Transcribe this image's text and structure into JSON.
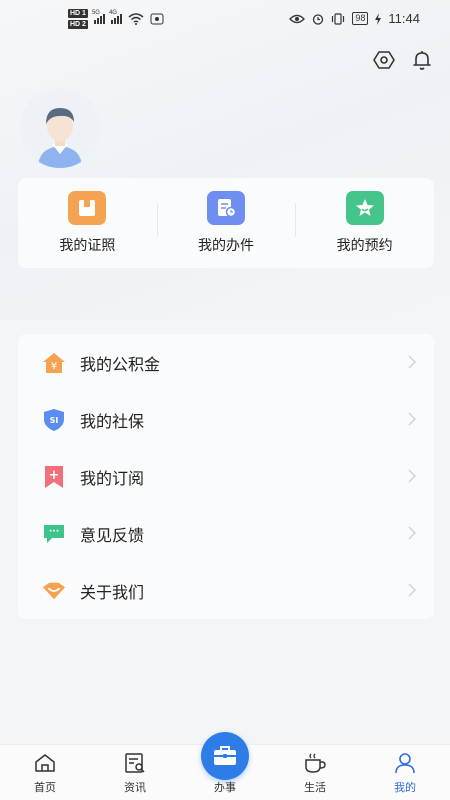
{
  "status_bar": {
    "hd1": "HD 1",
    "hd2": "HD 2",
    "sig1_tag": "5G",
    "sig2_tag": "4G",
    "battery": "98",
    "time": "11:44"
  },
  "services": [
    {
      "label": "我的证照",
      "icon": "license-icon",
      "color": "#f5a251"
    },
    {
      "label": "我的办件",
      "icon": "document-clock-icon",
      "color": "#6f8ff0"
    },
    {
      "label": "我的预约",
      "icon": "star-icon",
      "color": "#45c48b"
    }
  ],
  "menu": [
    {
      "label": "我的公积金",
      "icon": "housing-fund-icon",
      "color": "#f5a251",
      "glyph": "¥"
    },
    {
      "label": "我的社保",
      "icon": "social-security-shield-icon",
      "color": "#5b8df0",
      "glyph": "SI"
    },
    {
      "label": "我的订阅",
      "icon": "subscription-bookmark-icon",
      "color": "#f26f7c",
      "glyph": "+"
    },
    {
      "label": "意见反馈",
      "icon": "feedback-chat-icon",
      "color": "#3dc48b",
      "glyph": "···"
    },
    {
      "label": "关于我们",
      "icon": "about-us-icon",
      "color": "#f5a251",
      "glyph": ""
    }
  ],
  "tabs": [
    {
      "label": "首页",
      "icon": "home-icon"
    },
    {
      "label": "资讯",
      "icon": "news-icon"
    },
    {
      "label": "办事",
      "icon": "briefcase-icon"
    },
    {
      "label": "生活",
      "icon": "coffee-icon"
    },
    {
      "label": "我的",
      "icon": "user-icon",
      "active": true
    }
  ],
  "colors": {
    "accent": "#2f6fe0",
    "center_button": "#2d7ce8"
  }
}
